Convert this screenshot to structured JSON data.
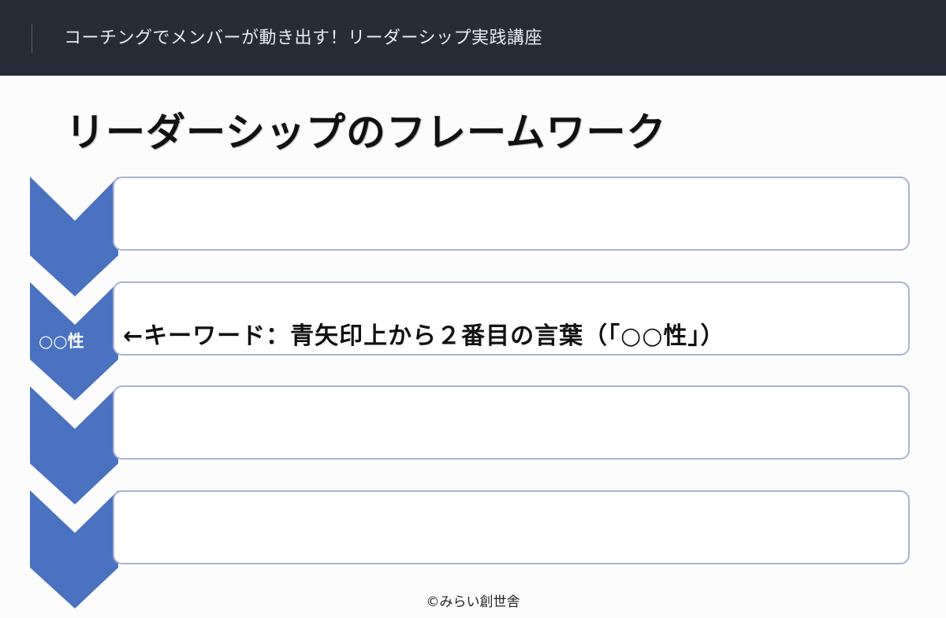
{
  "header": {
    "course_title": "コーチングでメンバーが動き出す！リーダーシップ実践講座"
  },
  "slide": {
    "heading": "リーダーシップのフレームワーク",
    "chevron_label": "○○性",
    "keyword_note": "←キーワード：青矢印上から２番目の言葉（「○○性」）",
    "footer": "©みらい創世舎",
    "colors": {
      "chevron": "#4a72c0",
      "box_border": "#aab3d1",
      "header_bg": "#272c37"
    }
  }
}
